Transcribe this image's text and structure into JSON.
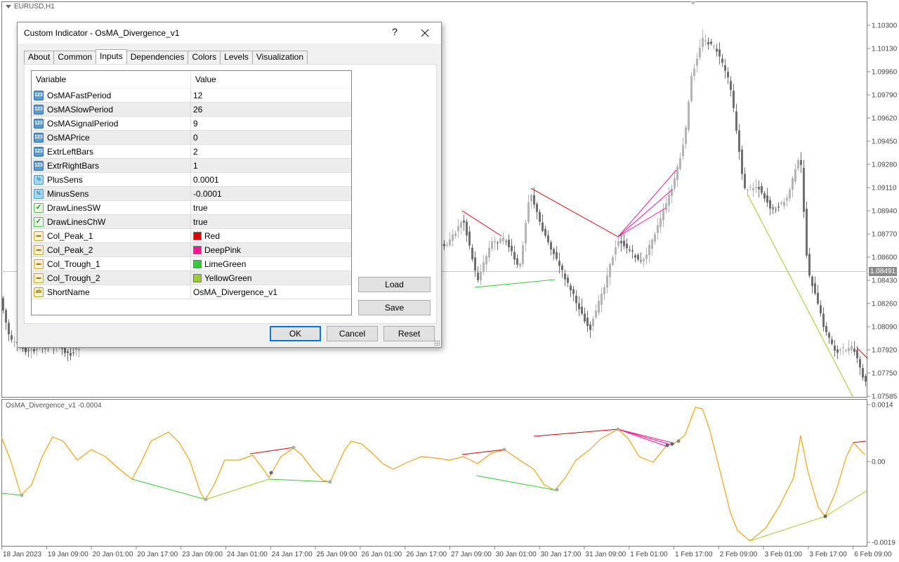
{
  "chart": {
    "title": "EURUSD,H1",
    "price_tag": "1.08491",
    "price_axis": [
      "1.10300",
      "1.10130",
      "1.09960",
      "1.09790",
      "1.09620",
      "1.09450",
      "1.09280",
      "1.09110",
      "1.08940",
      "1.08770",
      "1.08600",
      "1.08430",
      "1.08260",
      "1.08090",
      "1.07920",
      "1.07750",
      "1.07585"
    ],
    "time_axis": [
      "18 Jan 2023",
      "19 Jan 09:00",
      "20 Jan 01:00",
      "20 Jan 17:00",
      "23 Jan 09:00",
      "24 Jan 01:00",
      "24 Jan 17:00",
      "25 Jan 09:00",
      "26 Jan 01:00",
      "26 Jan 17:00",
      "27 Jan 09:00",
      "30 Jan 01:00",
      "30 Jan 17:00",
      "31 Jan 09:00",
      "1 Feb 01:00",
      "1 Feb 17:00",
      "2 Feb 09:00",
      "3 Feb 01:00",
      "3 Feb 17:00",
      "6 Feb 09:00"
    ],
    "sub_window": {
      "title": "OsMA_Divergence_v1 -0.0004",
      "axis": [
        "0.0014",
        "0.00",
        "-0.0019"
      ]
    },
    "colors": {
      "bull_candle": "#b4b4b4",
      "bear_candle": "#6e6e6e",
      "osma_line": "#f0a21a",
      "peak_1": "#dc0000",
      "peak_2": "#ff1493",
      "trough_1": "#32cd32",
      "trough_2": "#9acd32"
    }
  },
  "dialog": {
    "title": "Custom Indicator - OsMA_Divergence_v1",
    "help": "?",
    "tabs": [
      {
        "label": "About",
        "active": false
      },
      {
        "label": "Common",
        "active": false
      },
      {
        "label": "Inputs",
        "active": true
      },
      {
        "label": "Dependencies",
        "active": false
      },
      {
        "label": "Colors",
        "active": false
      },
      {
        "label": "Levels",
        "active": false
      },
      {
        "label": "Visualization",
        "active": false
      }
    ],
    "grid": {
      "col_variable": "Variable",
      "col_value": "Value",
      "rows": [
        {
          "icon": "int",
          "icon_text": "123",
          "name": "OsMAFastPeriod",
          "value": "12"
        },
        {
          "icon": "int",
          "icon_text": "123",
          "name": "OsMASlowPeriod",
          "value": "26"
        },
        {
          "icon": "int",
          "icon_text": "123",
          "name": "OsMASignalPeriod",
          "value": "9"
        },
        {
          "icon": "int",
          "icon_text": "123",
          "name": "OsMAPrice",
          "value": "0"
        },
        {
          "icon": "int",
          "icon_text": "123",
          "name": "ExtrLeftBars",
          "value": "2"
        },
        {
          "icon": "int",
          "icon_text": "123",
          "name": "ExtrRightBars",
          "value": "1"
        },
        {
          "icon": "dbl",
          "icon_text": "½",
          "name": "PlusSens",
          "value": "0.0001"
        },
        {
          "icon": "dbl",
          "icon_text": "½",
          "name": "MinusSens",
          "value": "-0.0001"
        },
        {
          "icon": "bool",
          "icon_text": "✓",
          "name": "DrawLinesSW",
          "value": "true"
        },
        {
          "icon": "bool",
          "icon_text": "✓",
          "name": "DrawLinesChW",
          "value": "true"
        },
        {
          "icon": "color",
          "icon_text": "▬",
          "name": "Col_Peak_1",
          "value": "Red",
          "swatch": "#e00000"
        },
        {
          "icon": "color",
          "icon_text": "▬",
          "name": "Col_Peak_2",
          "value": "DeepPink",
          "swatch": "#ff1493"
        },
        {
          "icon": "color",
          "icon_text": "▬",
          "name": "Col_Trough_1",
          "value": "LimeGreen",
          "swatch": "#32cd32"
        },
        {
          "icon": "color",
          "icon_text": "▬",
          "name": "Col_Trough_2",
          "value": "YellowGreen",
          "swatch": "#9acd32"
        },
        {
          "icon": "str",
          "icon_text": "ab",
          "name": "ShortName",
          "value": "OsMA_Divergence_v1"
        }
      ]
    },
    "buttons": {
      "load": "Load",
      "save": "Save",
      "ok": "OK",
      "cancel": "Cancel",
      "reset": "Reset"
    }
  }
}
